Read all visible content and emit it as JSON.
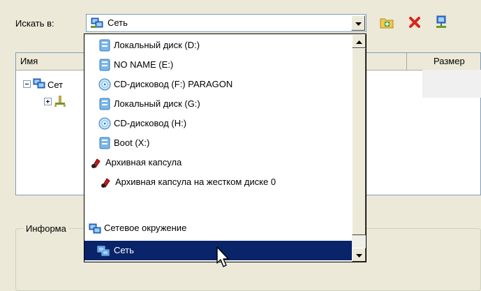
{
  "dialog": {
    "look_in_label": "Искать в:",
    "combo_value": "Сеть"
  },
  "list": {
    "columns": [
      "Имя",
      "Размер"
    ],
    "tree_row_1": "Сет"
  },
  "info_group_label": "Информа",
  "dropdown": {
    "items": [
      {
        "label": "Локальный диск (D:)",
        "icon": "drive-icon"
      },
      {
        "label": "NO NAME (E:)",
        "icon": "drive-icon"
      },
      {
        "label": "CD-дисковод (F:) PARAGON",
        "icon": "cd-icon"
      },
      {
        "label": "Локальный диск (G:)",
        "icon": "drive-icon"
      },
      {
        "label": "CD-дисковод (H:)",
        "icon": "cd-icon"
      },
      {
        "label": "Boot (X:)",
        "icon": "drive-icon"
      },
      {
        "label": "Архивная капсула",
        "icon": "capsule-icon"
      },
      {
        "label": "Архивная капсула на жестком диске 0",
        "icon": "capsule-icon"
      },
      {
        "label": "Сетевое окружение",
        "icon": "network-icon"
      },
      {
        "label": "Сеть",
        "icon": "network-icon",
        "selected": true
      }
    ]
  },
  "colors": {
    "selection": "#0a246a",
    "face": "#ece9d8"
  }
}
